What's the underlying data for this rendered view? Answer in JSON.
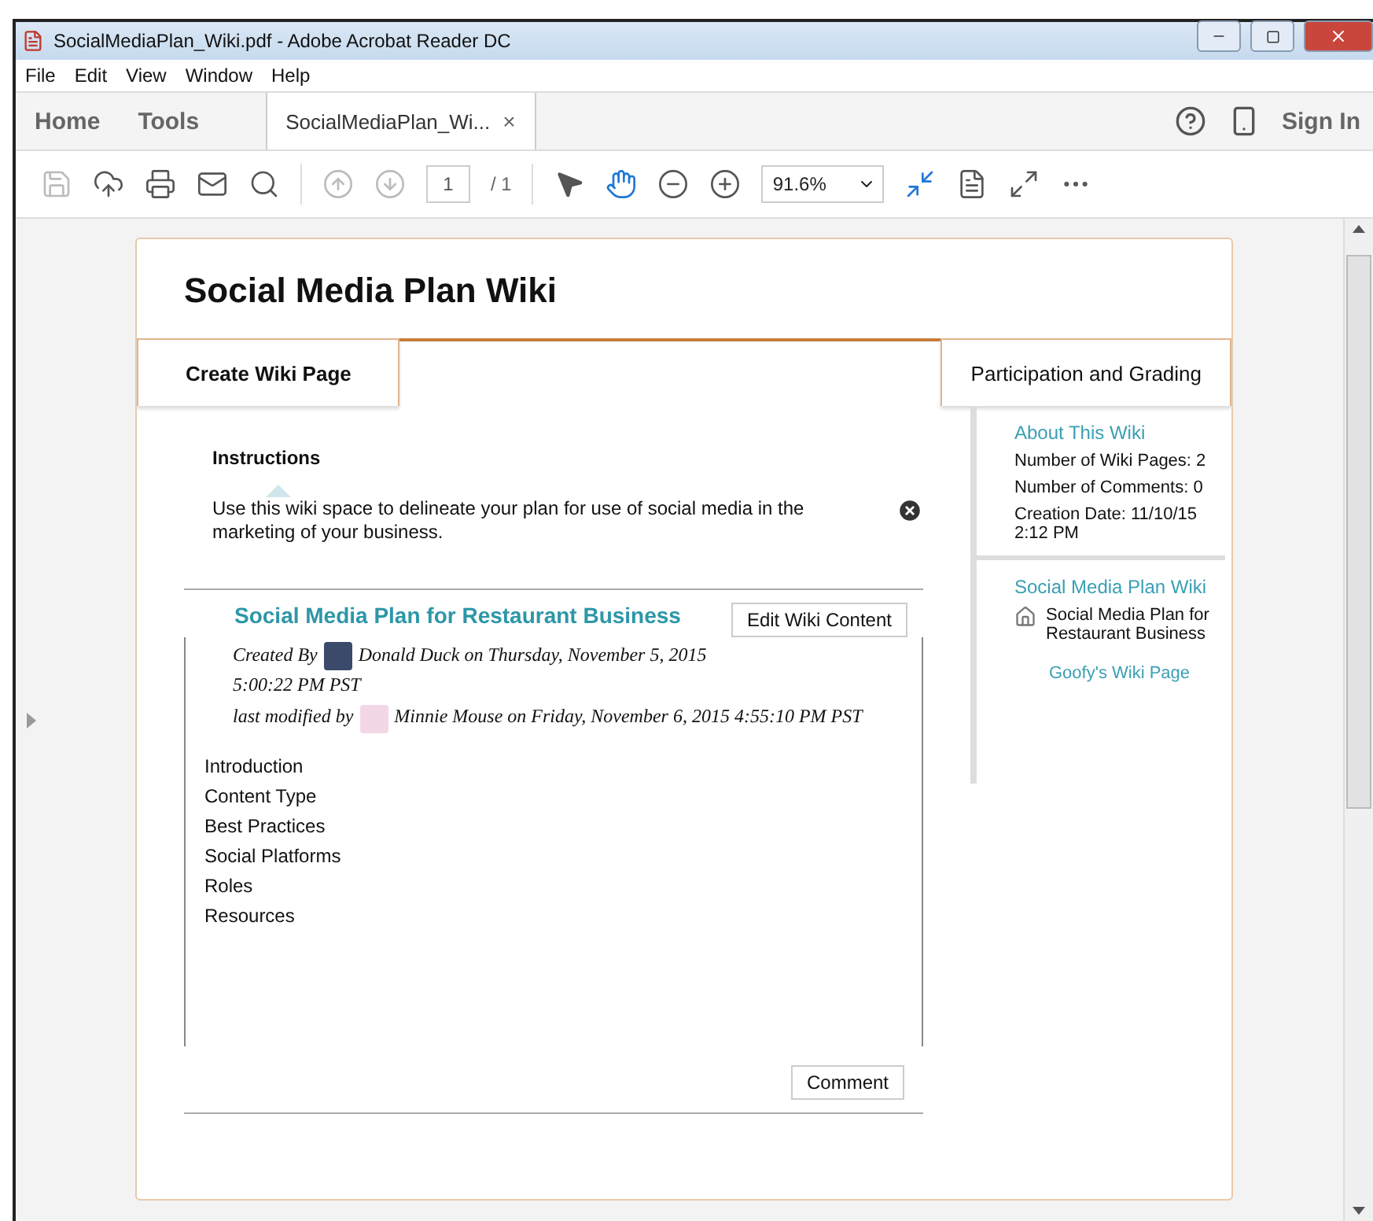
{
  "window": {
    "title": "SocialMediaPlan_Wiki.pdf - Adobe Acrobat Reader DC"
  },
  "menu": [
    "File",
    "Edit",
    "View",
    "Window",
    "Help"
  ],
  "nav_tabs": [
    {
      "label": "Home",
      "selected": false
    },
    {
      "label": "Tools",
      "selected": false
    },
    {
      "label": "SocialMediaPlan_Wi...",
      "selected": true,
      "close": "×"
    }
  ],
  "sign_in": "Sign In",
  "toolbar": {
    "page_number": "1",
    "page_total": "/ 1",
    "zoom": "91.6%"
  },
  "page": {
    "title": "Social Media Plan Wiki",
    "tabs": [
      {
        "label": "Create Wiki Page",
        "selected": true
      },
      {
        "label": "Participation and Grading",
        "selected": false
      }
    ],
    "instructions": {
      "heading": "Instructions",
      "text": "Use this wiki space to delineate your plan for use of social media in the marketing of your business."
    },
    "entry": {
      "title": "Social Media Plan for Restaurant Business",
      "edit_button": "Edit Wiki Content",
      "created_label": "Created By",
      "created_text": "Donald Duck on Thursday, November 5, 2015 5:00:22 PM PST",
      "modified_label": "last modified by",
      "modified_text": "Minnie Mouse on Friday, November 6, 2015 4:55:10 PM PST",
      "sections": [
        "Introduction",
        "Content Type",
        "Best Practices",
        "Social Platforms",
        "Roles",
        "Resources"
      ],
      "comment_button": "Comment"
    },
    "sidebar": {
      "about_heading": "About This Wiki",
      "stats": [
        "Number of Wiki Pages: 2",
        "Number of Comments: 0",
        "Creation Date: 11/10/15 2:12 PM"
      ],
      "wiki_heading": "Social Media Plan Wiki",
      "pages": [
        {
          "kind": "home",
          "label": "Social Media Plan for Restaurant Business"
        },
        {
          "kind": "link",
          "label": "Goofy's Wiki Page"
        }
      ]
    }
  }
}
